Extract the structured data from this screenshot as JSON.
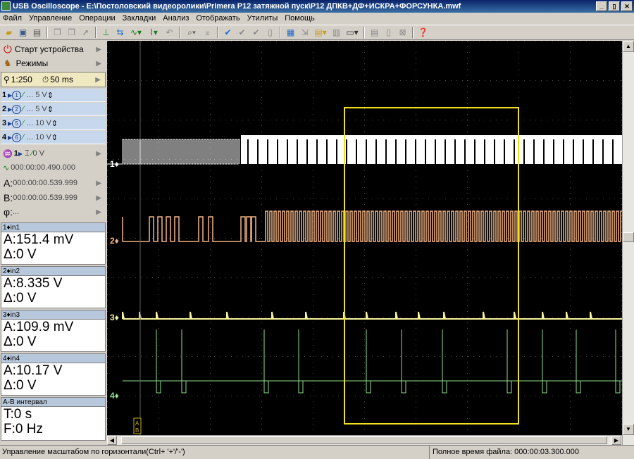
{
  "window": {
    "title": "USB Oscilloscope - E:\\Постоловский видеоролики\\Primera P12 затяжной пуск\\P12 ДПКВ+ДФ+ИСКРА+ФОРСУНКА.mwf",
    "min": "_",
    "max": "▯",
    "close": "✕"
  },
  "menu": [
    "Файл",
    "Управление",
    "Операции",
    "Закладки",
    "Анализ",
    "Отображать",
    "Утилиты",
    "Помощь"
  ],
  "toolbar_icons": [
    "open-icon",
    "save-icon",
    "print-icon",
    "copy-icon",
    "paste-icon",
    "export-icon",
    "cursor-icon",
    "ruler-icon",
    "sine-icon",
    "wave-icon",
    "undo-icon",
    "zoom-icon",
    "marker-icon",
    "check-icon",
    "check2-icon",
    "check3-icon",
    "doc-icon",
    "grid-icon",
    "import-icon",
    "stop-icon",
    "window-icon",
    "table-icon",
    "list-icon",
    "close-doc-icon",
    "help-icon"
  ],
  "left": {
    "start_device": "Старт устройства",
    "modes": "Режимы",
    "scale": "1:250",
    "timebase": "50 ms",
    "channels": [
      {
        "num": "1",
        "src": "1",
        "volts": "... 5 V"
      },
      {
        "num": "2",
        "src": "2",
        "volts": "... 5 V"
      },
      {
        "num": "3",
        "src": "5",
        "volts": "... 10 V"
      },
      {
        "num": "4",
        "src": "6",
        "volts": "... 10 V"
      }
    ],
    "trigger_ch": "1",
    "trigger_level": "0 V",
    "trigger_time": "000:00:00.490.000",
    "cursor_a_label": "A:",
    "cursor_a": "000:00:00.539.999",
    "cursor_b_label": "B:",
    "cursor_b": "000:00:00.539.999",
    "phi_label": "φ:",
    "phi": "..."
  },
  "readouts": [
    {
      "header": "1♦in1",
      "a": "A:151.4 mV",
      "d": "Δ:0 V"
    },
    {
      "header": "2♦in2",
      "a": "A:8.335 V",
      "d": "Δ:0 V"
    },
    {
      "header": "3♦in3",
      "a": "A:109.9 mV",
      "d": "Δ:0 V"
    },
    {
      "header": "4♦in4",
      "a": "A:10.17 V",
      "d": "Δ:0 V"
    }
  ],
  "interval": {
    "header": "A-B интервал",
    "t": "T:0 s",
    "f": "F:0 Hz"
  },
  "scope": {
    "channel_labels": [
      "1♦",
      "2♦",
      "3♦",
      "4♦"
    ],
    "colors": {
      "ch1": "#ffffff",
      "ch2": "#f4b486",
      "ch3": "#f6f29a",
      "ch4": "#8ee08e",
      "selection": "#f0e020"
    },
    "cursor_marker": "AB"
  },
  "status": {
    "left": "Управление масштабом по горизонтали(Ctrl+ '+'/'-')",
    "right": "Полное время файла: 000:00:03.300.000"
  }
}
